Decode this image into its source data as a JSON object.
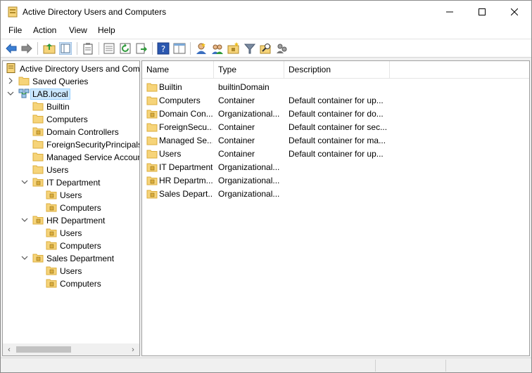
{
  "window": {
    "title": "Active Directory Users and Computers",
    "controls": {
      "minimize": "—",
      "maximize": "☐",
      "close": "✕"
    }
  },
  "menu": [
    "File",
    "Action",
    "View",
    "Help"
  ],
  "toolbar_icons": [
    "back-arrow-icon",
    "forward-arrow-icon",
    "up-folder-icon",
    "show-hide-console-tree-icon",
    "clipboard-icon",
    "export-list-icon",
    "refresh-icon",
    "export-icon",
    "help-icon",
    "properties-pane-icon",
    "new-user-icon",
    "new-group-icon",
    "new-ou-icon",
    "filter-icon",
    "find-icon",
    "delegate-control-icon"
  ],
  "tree": {
    "root": "Active Directory Users and Com",
    "saved_queries": "Saved Queries",
    "domain": "LAB.local",
    "items": [
      {
        "label": "Builtin",
        "type": "folder"
      },
      {
        "label": "Computers",
        "type": "folder"
      },
      {
        "label": "Domain Controllers",
        "type": "ou"
      },
      {
        "label": "ForeignSecurityPrincipals",
        "type": "folder"
      },
      {
        "label": "Managed Service Accoun",
        "type": "folder"
      },
      {
        "label": "Users",
        "type": "folder"
      }
    ],
    "ous": [
      {
        "label": "IT Department",
        "children": [
          "Users",
          "Computers"
        ]
      },
      {
        "label": "HR Department",
        "children": [
          "Users",
          "Computers"
        ]
      },
      {
        "label": "Sales Department",
        "children": [
          "Users",
          "Computers"
        ]
      }
    ]
  },
  "list": {
    "columns": [
      "Name",
      "Type",
      "Description"
    ],
    "rows": [
      {
        "name": "Builtin",
        "type": "builtinDomain",
        "description": "",
        "icon": "folder"
      },
      {
        "name": "Computers",
        "type": "Container",
        "description": "Default container for up...",
        "icon": "folder"
      },
      {
        "name": "Domain Con...",
        "type": "Organizational...",
        "description": "Default container for do...",
        "icon": "ou"
      },
      {
        "name": "ForeignSecu...",
        "type": "Container",
        "description": "Default container for sec...",
        "icon": "folder"
      },
      {
        "name": "Managed Se...",
        "type": "Container",
        "description": "Default container for ma...",
        "icon": "folder"
      },
      {
        "name": "Users",
        "type": "Container",
        "description": "Default container for up...",
        "icon": "folder"
      },
      {
        "name": "IT Department",
        "type": "Organizational...",
        "description": "",
        "icon": "ou"
      },
      {
        "name": "HR Departm...",
        "type": "Organizational...",
        "description": "",
        "icon": "ou"
      },
      {
        "name": "Sales Depart...",
        "type": "Organizational...",
        "description": "",
        "icon": "ou"
      }
    ]
  },
  "colors": {
    "folder": "#f6d47a",
    "folder_dark": "#dcae3c",
    "selection": "#cce8ff",
    "selection_border": "#99d1ff"
  }
}
